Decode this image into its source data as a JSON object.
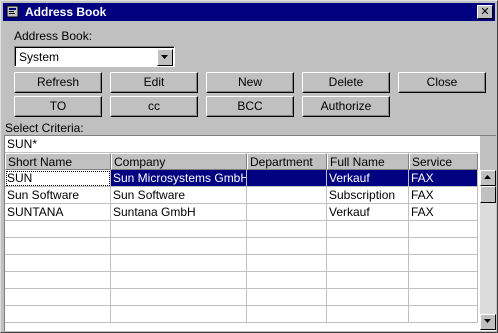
{
  "window": {
    "title": "Address Book",
    "close_glyph": "✕",
    "icon": "book-icon"
  },
  "address_book": {
    "label": "Address Book:",
    "selected": "System"
  },
  "buttons": {
    "refresh": "Refresh",
    "edit": "Edit",
    "new": "New",
    "delete": "Delete",
    "close": "Close",
    "to": "TO",
    "cc": "cc",
    "bcc": "BCC",
    "authorize": "Authorize"
  },
  "criteria": {
    "label": "Select Criteria:",
    "value": "SUN*"
  },
  "table": {
    "columns": [
      "Short Name",
      "Company",
      "Department",
      "Full Name",
      "Service"
    ],
    "rows": [
      {
        "short_name": "SUN",
        "company": "Sun Microsystems GmbH",
        "department": "",
        "full_name": "Verkauf",
        "service": "FAX",
        "selected": true
      },
      {
        "short_name": "Sun Software",
        "company": "Sun Software",
        "department": "",
        "full_name": "Subscription",
        "service": "FAX"
      },
      {
        "short_name": "SUNTANA",
        "company": "Suntana GmbH",
        "department": "",
        "full_name": "Verkauf",
        "service": "FAX"
      }
    ]
  },
  "colors": {
    "titlebar": "#000080",
    "selection": "#000080",
    "face": "#c0c0c0"
  }
}
